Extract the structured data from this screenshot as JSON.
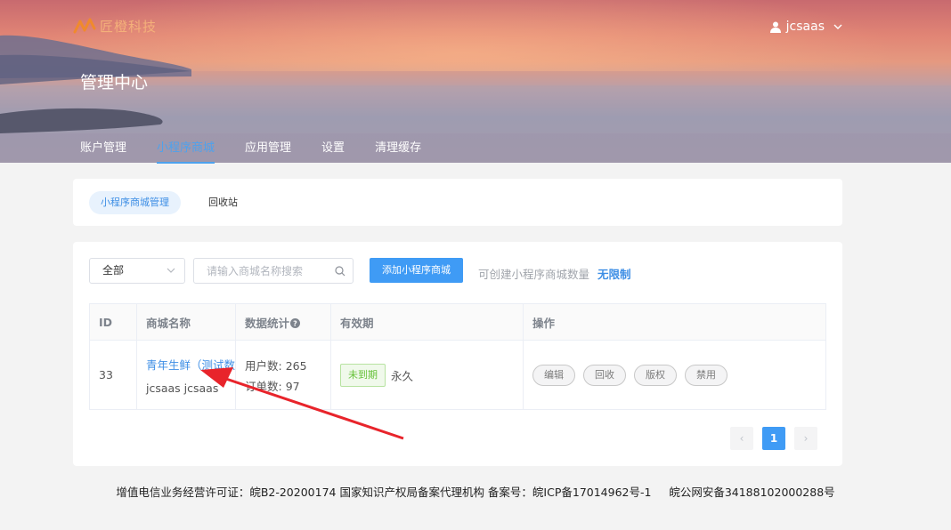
{
  "header": {
    "logo_text": "匠橙科技",
    "user_name": "jcsaas",
    "page_title": "管理中心",
    "nav": [
      {
        "label": "账户管理"
      },
      {
        "label": "小程序商城",
        "active": true
      },
      {
        "label": "应用管理"
      },
      {
        "label": "设置"
      },
      {
        "label": "清理缓存"
      }
    ]
  },
  "tabs": [
    {
      "label": "小程序商城管理",
      "active": true
    },
    {
      "label": "回收站"
    }
  ],
  "toolbar": {
    "filter_value": "全部",
    "search_placeholder": "请输入商城名称搜索",
    "add_button": "添加小程序商城",
    "quota_label": "可创建小程序商城数量",
    "quota_value": "无限制"
  },
  "table": {
    "headers": [
      "ID",
      "商城名称",
      "数据统计",
      "有效期",
      "操作"
    ],
    "rows": [
      {
        "id": "33",
        "name": "青年生鲜（测试数",
        "owner": "jcsaas jcsaas",
        "users": "用户数: 265",
        "orders": "订单数: 97",
        "badge": "未到期",
        "validity": "永久",
        "actions": [
          "编辑",
          "回收",
          "版权",
          "禁用"
        ]
      }
    ]
  },
  "pagination": {
    "prev": "‹",
    "current": "1",
    "next": "›"
  },
  "footer": "增值电信业务经营许可证：皖B2-20200174 国家知识产权局备案代理机构 备案号：皖ICP备17014962号-1     皖公网安备34188102000288号",
  "colors": {
    "accent": "#3f9bf5",
    "link": "#3d8ee5",
    "success": "#67c23a",
    "arrow": "#e8242b"
  }
}
